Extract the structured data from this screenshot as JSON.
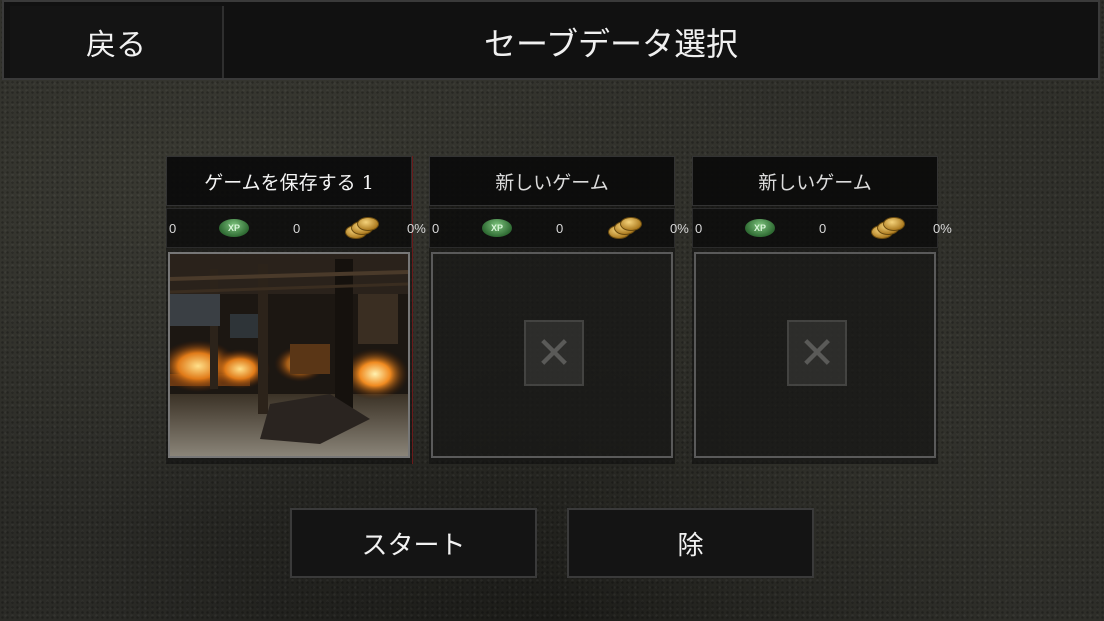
{
  "header": {
    "back_label": "戻る",
    "title": "セーブデータ選択"
  },
  "slots": [
    {
      "title": "ゲームを保存する 1",
      "xp": "0",
      "coins": "0",
      "progress": "0%",
      "has_save": true
    },
    {
      "title": "新しいゲーム",
      "xp": "0",
      "coins": "0",
      "progress": "0%",
      "has_save": false
    },
    {
      "title": "新しいゲーム",
      "xp": "0",
      "coins": "0",
      "progress": "0%",
      "has_save": false
    }
  ],
  "icons": {
    "xp_badge_text": "XP",
    "empty_slot": "x-mark-icon",
    "coin": "coin-stack-icon"
  },
  "actions": {
    "start_label": "スタート",
    "delete_label": "除"
  },
  "colors": {
    "background": "#2b2b27",
    "panel": "#141414",
    "xp_green": "#4f9a52",
    "coin_gold": "#d9a93c"
  }
}
